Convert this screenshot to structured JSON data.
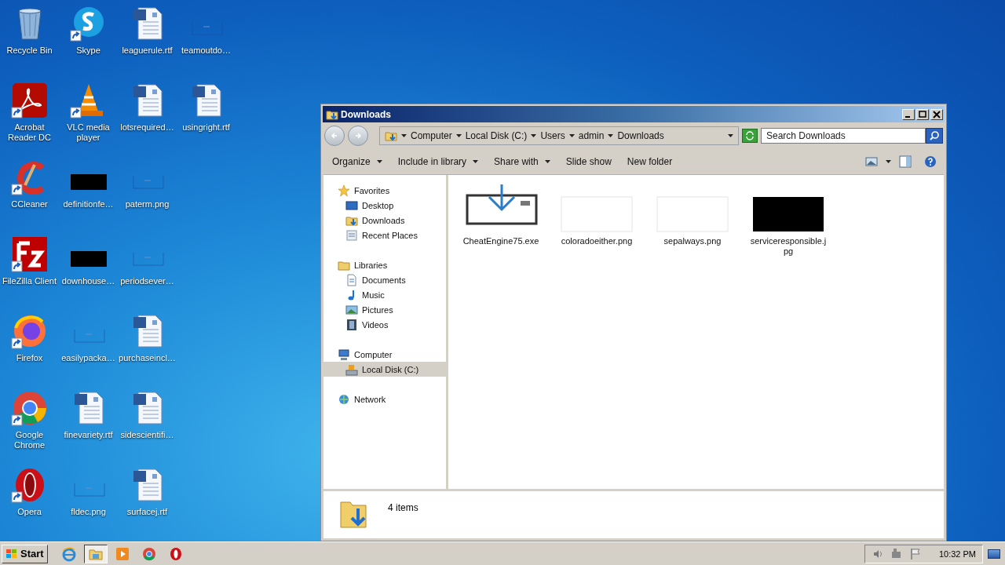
{
  "desktop": {
    "columns": [
      [
        {
          "label": "Recycle Bin",
          "kind": "recycle",
          "shortcut": false
        },
        {
          "label": "Acrobat Reader DC",
          "kind": "acrobat",
          "shortcut": true
        },
        {
          "label": "CCleaner",
          "kind": "ccleaner",
          "shortcut": true
        },
        {
          "label": "FileZilla Client",
          "kind": "filezilla",
          "shortcut": true
        },
        {
          "label": "Firefox",
          "kind": "firefox",
          "shortcut": true
        },
        {
          "label": "Google Chrome",
          "kind": "chrome",
          "shortcut": true
        },
        {
          "label": "Opera",
          "kind": "opera",
          "shortcut": true
        }
      ],
      [
        {
          "label": "Skype",
          "kind": "skype",
          "shortcut": true
        },
        {
          "label": "VLC media player",
          "kind": "vlc",
          "shortcut": true
        },
        {
          "label": "definitionfe…",
          "kind": "black-image",
          "shortcut": false
        },
        {
          "label": "downhouse…",
          "kind": "black-image",
          "shortcut": false
        },
        {
          "label": "easilypacka…",
          "kind": "blank-image",
          "shortcut": false
        },
        {
          "label": "finevariety.rtf",
          "kind": "document",
          "shortcut": false
        },
        {
          "label": "fldec.png",
          "kind": "blank-image",
          "shortcut": false
        }
      ],
      [
        {
          "label": "leaguerule.rtf",
          "kind": "document",
          "shortcut": false
        },
        {
          "label": "lotsrequired…",
          "kind": "document",
          "shortcut": false
        },
        {
          "label": "paterm.png",
          "kind": "blank-image",
          "shortcut": false
        },
        {
          "label": "periodsever…",
          "kind": "blank-image",
          "shortcut": false
        },
        {
          "label": "purchaseincl…",
          "kind": "document",
          "shortcut": false
        },
        {
          "label": "sidescientifi…",
          "kind": "document",
          "shortcut": false
        },
        {
          "label": "surfacej.rtf",
          "kind": "document",
          "shortcut": false
        }
      ],
      [
        {
          "label": "teamoutdo…",
          "kind": "blank-image",
          "shortcut": false
        },
        {
          "label": "usingright.rtf",
          "kind": "document",
          "shortcut": false
        }
      ]
    ]
  },
  "window": {
    "title": "Downloads",
    "breadcrumb": [
      "Computer",
      "Local Disk (C:)",
      "Users",
      "admin",
      "Downloads"
    ],
    "search": {
      "placeholder": "Search Downloads"
    },
    "toolbar": [
      {
        "label": "Organize",
        "dropdown": true
      },
      {
        "label": "Include in library",
        "dropdown": true
      },
      {
        "label": "Share with",
        "dropdown": true
      },
      {
        "label": "Slide show",
        "dropdown": false
      },
      {
        "label": "New folder",
        "dropdown": false
      }
    ],
    "nav": [
      {
        "label": "Favorites",
        "kind": "star",
        "selected": false,
        "children": [
          {
            "label": "Desktop",
            "kind": "desktop",
            "selected": false
          },
          {
            "label": "Downloads",
            "kind": "downloads",
            "selected": false
          },
          {
            "label": "Recent Places",
            "kind": "recent",
            "selected": false
          }
        ]
      },
      {
        "label": "Libraries",
        "kind": "library",
        "selected": false,
        "children": [
          {
            "label": "Documents",
            "kind": "documents",
            "selected": false
          },
          {
            "label": "Music",
            "kind": "music",
            "selected": false
          },
          {
            "label": "Pictures",
            "kind": "pictures",
            "selected": false
          },
          {
            "label": "Videos",
            "kind": "videos",
            "selected": false
          }
        ]
      },
      {
        "label": "Computer",
        "kind": "computer",
        "selected": false,
        "children": [
          {
            "label": "Local Disk (C:)",
            "kind": "disk",
            "selected": true
          }
        ]
      },
      {
        "label": "Network",
        "kind": "network",
        "selected": false
      }
    ],
    "files": [
      {
        "name": "CheatEngine75.exe",
        "kind": "installer"
      },
      {
        "name": "coloradoeither.png",
        "kind": "white-image"
      },
      {
        "name": "sepalways.png",
        "kind": "white-image"
      },
      {
        "name": "serviceresponsible.jpg",
        "kind": "black-image"
      }
    ],
    "status": "4 items"
  },
  "taskbar": {
    "start": "Start",
    "apps": [
      {
        "kind": "ie",
        "selected": false
      },
      {
        "kind": "explorer",
        "selected": true
      },
      {
        "kind": "media",
        "selected": false
      },
      {
        "kind": "chrome",
        "selected": false
      },
      {
        "kind": "opera",
        "selected": false
      }
    ],
    "clock": "10:32 PM"
  }
}
